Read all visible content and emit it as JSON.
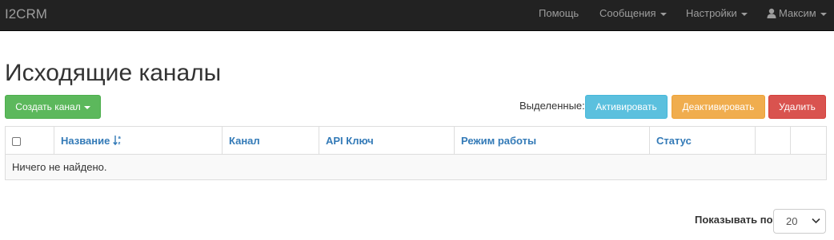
{
  "navbar": {
    "brand": "I2CRM",
    "help": "Помощь",
    "messages": "Сообщения",
    "settings": "Настройки",
    "user": "Максим"
  },
  "page": {
    "title": "Исходящие каналы"
  },
  "toolbar": {
    "create_label": "Создать канал",
    "selected_label": "Выделенные:",
    "activate_label": "Активировать",
    "deactivate_label": "Деактивировать",
    "delete_label": "Удалить"
  },
  "table": {
    "columns": [
      "",
      "Название",
      "Канал",
      "API Ключ",
      "Режим работы",
      "Статус",
      "",
      ""
    ],
    "empty_message": "Ничего не найдено."
  },
  "pagination": {
    "page_size_label": "Показывать по",
    "page_size_value": "20"
  },
  "colors": {
    "navbar_bg": "#222222",
    "success": "#5cb85c",
    "info": "#5bc0de",
    "warning": "#f0ad4e",
    "danger": "#d9534f",
    "link": "#337ab7"
  },
  "icons": {
    "user": "user-icon",
    "sort": "sort-alpha-icon",
    "caret": "caret-down-icon"
  }
}
